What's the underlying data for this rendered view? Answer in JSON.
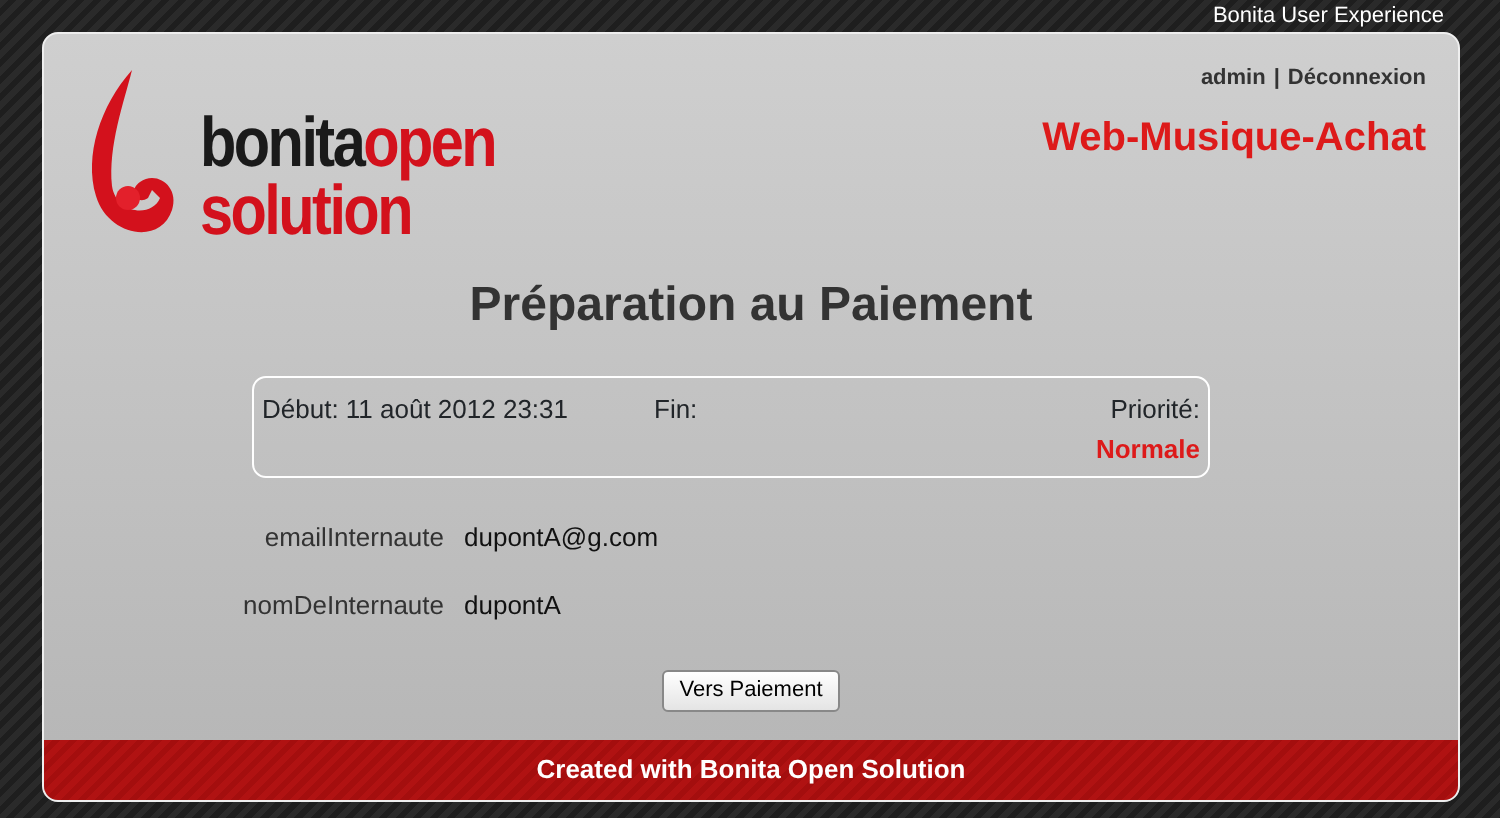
{
  "top_bar": {
    "title": "Bonita User Experience"
  },
  "logo": {
    "word_1": "bonita",
    "word_2": "open",
    "word_3": "solution"
  },
  "header": {
    "user": "admin",
    "separator": "|",
    "logout": "Déconnexion",
    "process": "Web-Musique-Achat"
  },
  "title": "Préparation au Paiement",
  "info": {
    "start": "Début: 11 août 2012 23:31",
    "end": "Fin:",
    "priority_label": "Priorité:",
    "priority": "Normale"
  },
  "fields": [
    {
      "label": "emailInternaute",
      "value": "dupontA@g.com"
    },
    {
      "label": "nomDeInternaute",
      "value": "dupontA"
    }
  ],
  "button": "Vers Paiement",
  "footer": "Created with Bonita Open Solution"
}
